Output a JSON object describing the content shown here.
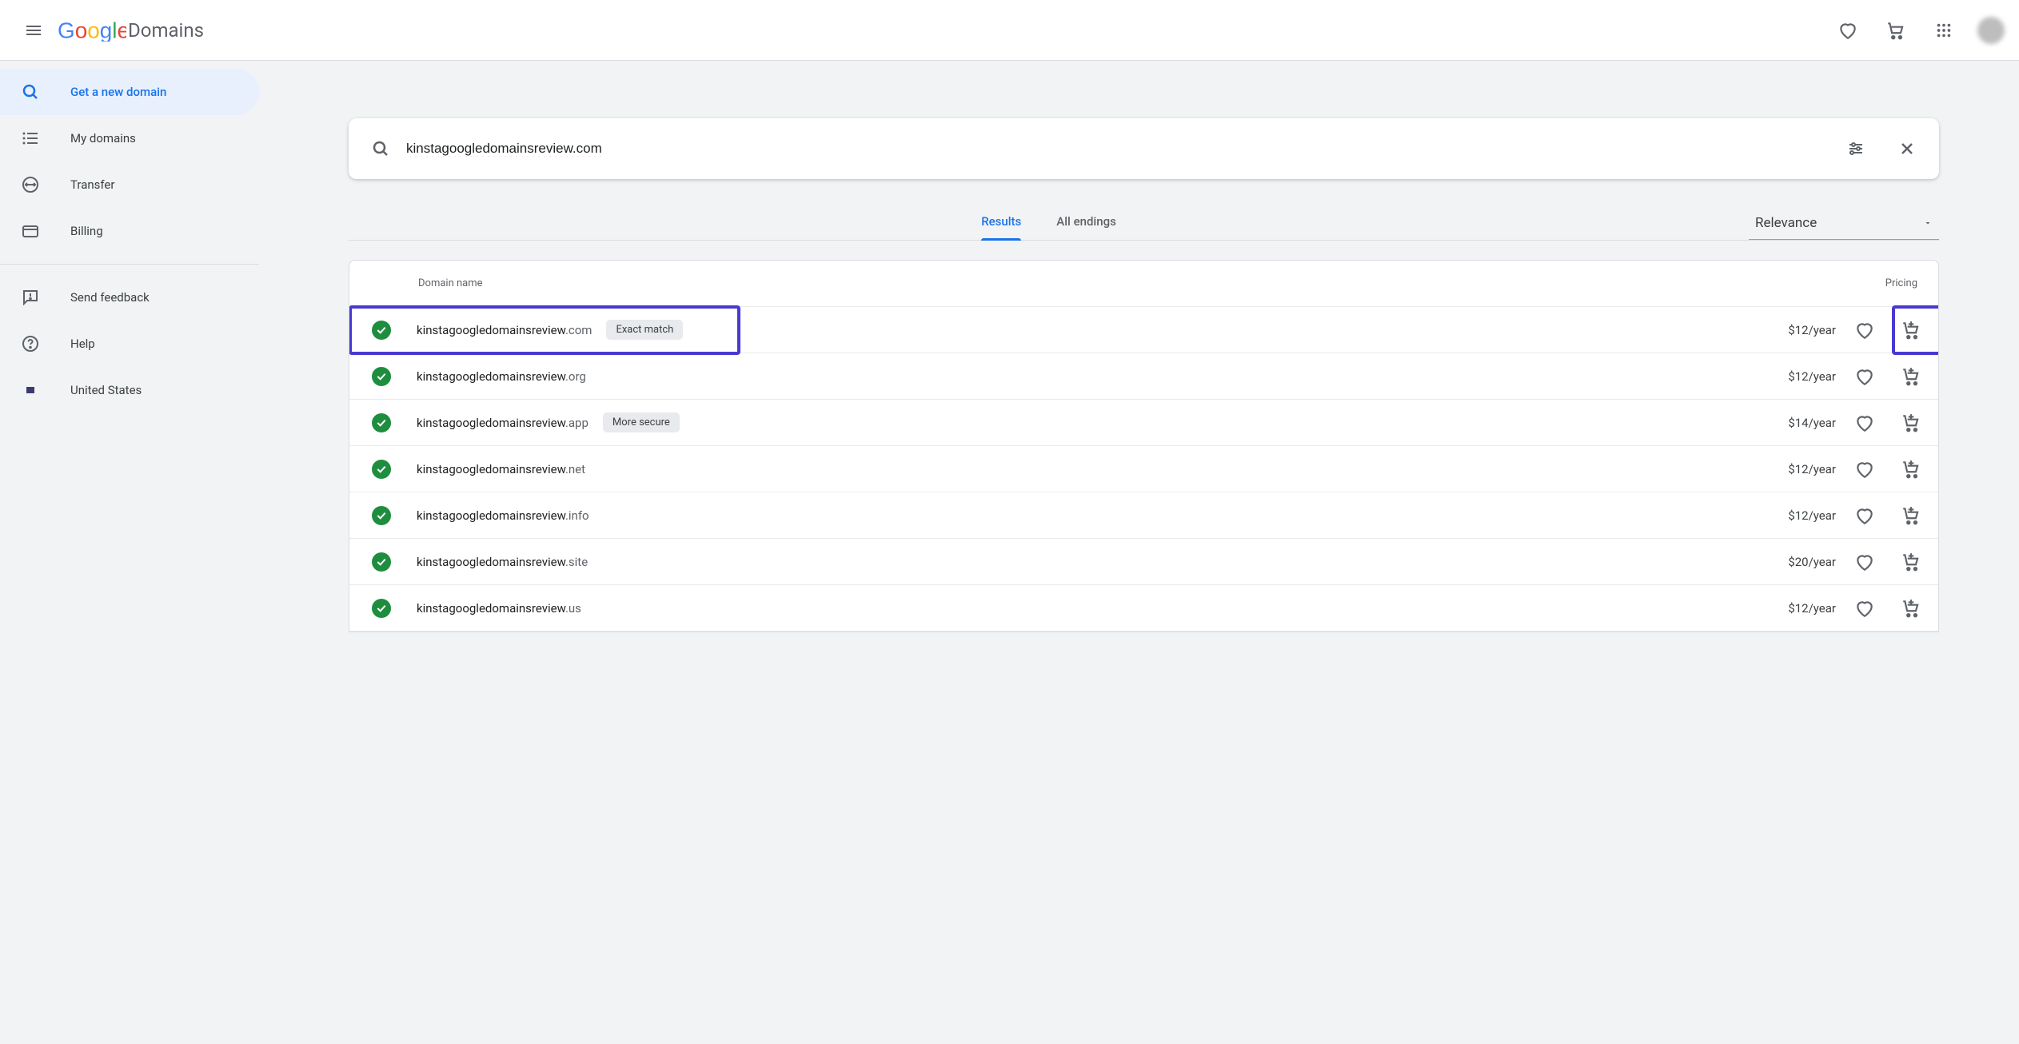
{
  "header": {
    "product_name": "Domains"
  },
  "sidebar": {
    "items": [
      {
        "label": "Get a new domain"
      },
      {
        "label": "My domains"
      },
      {
        "label": "Transfer"
      },
      {
        "label": "Billing"
      },
      {
        "label": "Send feedback"
      },
      {
        "label": "Help"
      },
      {
        "label": "United States"
      }
    ]
  },
  "search": {
    "query": "kinstagoogledomainsreview.com"
  },
  "tabs": {
    "results": "Results",
    "all_endings": "All endings"
  },
  "sort": {
    "selected": "Relevance"
  },
  "results_header": {
    "name": "Domain name",
    "price": "Pricing"
  },
  "results": [
    {
      "name": "kinstagoogledomainsreview",
      "tld": ".com",
      "tag": "Exact match",
      "price": "$12/year"
    },
    {
      "name": "kinstagoogledomainsreview",
      "tld": ".org",
      "tag": "",
      "price": "$12/year"
    },
    {
      "name": "kinstagoogledomainsreview",
      "tld": ".app",
      "tag": "More secure",
      "price": "$14/year"
    },
    {
      "name": "kinstagoogledomainsreview",
      "tld": ".net",
      "tag": "",
      "price": "$12/year"
    },
    {
      "name": "kinstagoogledomainsreview",
      "tld": ".info",
      "tag": "",
      "price": "$12/year"
    },
    {
      "name": "kinstagoogledomainsreview",
      "tld": ".site",
      "tag": "",
      "price": "$20/year"
    },
    {
      "name": "kinstagoogledomainsreview",
      "tld": ".us",
      "tag": "",
      "price": "$12/year"
    }
  ]
}
